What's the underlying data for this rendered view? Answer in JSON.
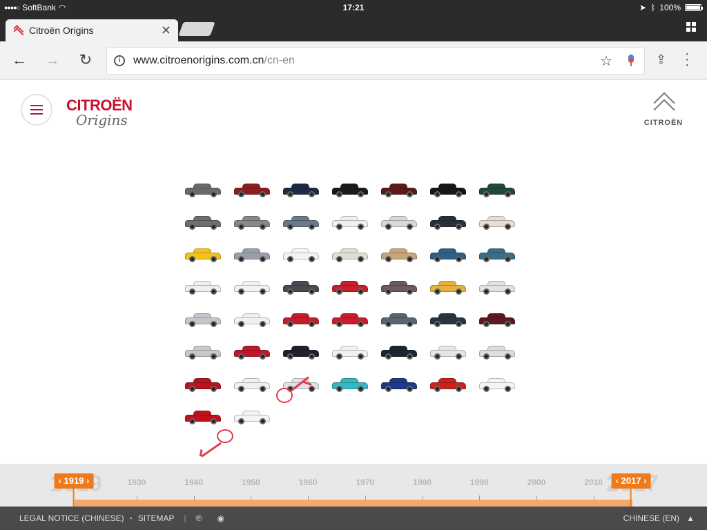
{
  "status": {
    "carrier": "SoftBank",
    "time": "17:21",
    "battery": "100%"
  },
  "browser": {
    "tab_title": "Citroën Origins",
    "url_host": "www.citroenorigins.com.cn",
    "url_path": "/cn-en"
  },
  "header": {
    "brand": "CITROËN",
    "brand_sub": "Origins",
    "right_logo_word": "CITROËN"
  },
  "cars": [
    [
      "#6a6a6a",
      "#8b1e1e",
      "#1d2b45",
      "#1a1a1a",
      "#5e1a1a",
      "#161616",
      "#1f4a36"
    ],
    [
      "#6e6e6e",
      "#888888",
      "#6b7a8a",
      "#f0f0f0",
      "#d9d9d9",
      "#2a2f3a",
      "#e8ddd0"
    ],
    [
      "#f2c21b",
      "#9aa0aa",
      "#f4f4f4",
      "#e2ddd4",
      "#c9a47a",
      "#2f5f86",
      "#3b6d8a"
    ],
    [
      "#eeeeee",
      "#f2f2f2",
      "#4a4a52",
      "#c8202a",
      "#6e5a5a",
      "#e8b23a",
      "#dfe3e8"
    ],
    [
      "#c3c7cc",
      "#f0f0f0",
      "#c21d2a",
      "#c81e2b",
      "#5a6470",
      "#2c3442",
      "#5c1a26"
    ],
    [
      "#c5c8cc",
      "#c0162a",
      "#1e2230",
      "#f2f2f2",
      "#1c2533",
      "#e4e6ea",
      "#dadde2"
    ],
    [
      "#b8141f",
      "#eef0f2",
      "#e2e2e4",
      "#35b7c4",
      "#1d3a8a",
      "#c8241c",
      "#f4f4f4"
    ],
    [
      "#c0101a",
      "#f4f4f4"
    ]
  ],
  "timeline": {
    "start_year": "1919",
    "end_year": "2017",
    "decades": [
      "1930",
      "1940",
      "1950",
      "1960",
      "1970",
      "1980",
      "1990",
      "2000",
      "2010"
    ],
    "ghost_start": "1919",
    "ghost_end": "2017"
  },
  "footer": {
    "legal": "LEGAL NOTICE (CHINESE)",
    "sitemap": "SITEMAP",
    "language": "CHINESE (EN)"
  }
}
